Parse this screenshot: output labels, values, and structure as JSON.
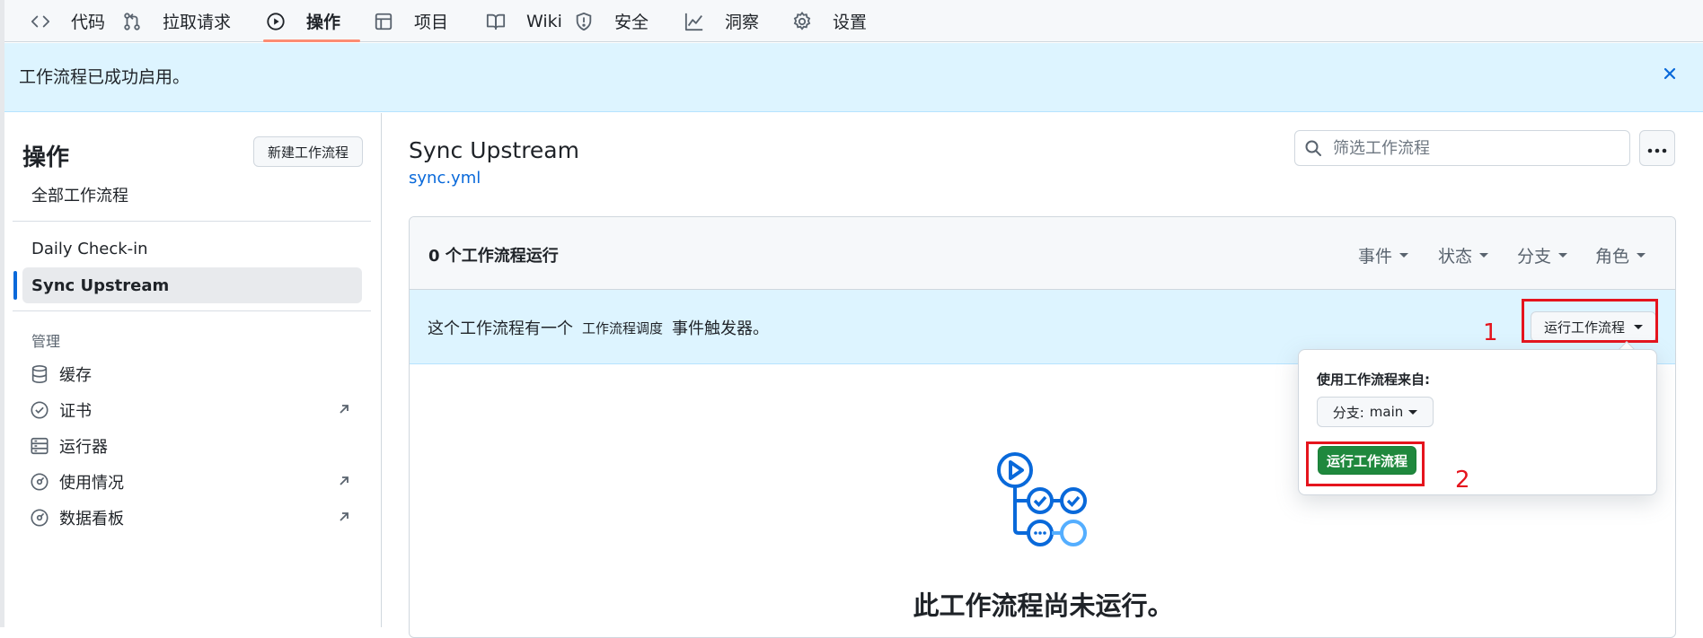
{
  "nav": {
    "tabs": [
      {
        "label": "代码",
        "icon": "code-icon"
      },
      {
        "label": "拉取请求",
        "icon": "pull-request-icon"
      },
      {
        "label": "操作",
        "icon": "play-icon",
        "selected": true
      },
      {
        "label": "项目",
        "icon": "table-icon"
      },
      {
        "label": "Wiki",
        "icon": "book-icon"
      },
      {
        "label": "安全",
        "icon": "shield-icon"
      },
      {
        "label": "洞察",
        "icon": "graph-icon"
      },
      {
        "label": "设置",
        "icon": "gear-icon"
      }
    ]
  },
  "flash": {
    "message": "工作流程已成功启用。",
    "close_icon": "close-icon"
  },
  "sidebar": {
    "title": "操作",
    "new_workflow_label": "新建工作流程",
    "all_workflows_label": "全部工作流程",
    "workflows": [
      {
        "label": "Daily Check-in",
        "selected": false
      },
      {
        "label": "Sync Upstream",
        "selected": true
      }
    ],
    "management_label": "管理",
    "management_items": [
      {
        "label": "缓存",
        "icon": "database-icon",
        "external": false
      },
      {
        "label": "证书",
        "icon": "check-circle-icon",
        "external": true
      },
      {
        "label": "运行器",
        "icon": "server-icon",
        "external": false
      },
      {
        "label": "使用情况",
        "icon": "meter-icon",
        "external": true
      },
      {
        "label": "数据看板",
        "icon": "meter-icon",
        "external": true
      }
    ]
  },
  "main": {
    "workflow_title": "Sync Upstream",
    "workflow_file": "sync.yml",
    "search_placeholder": "筛选工作流程",
    "runs_count_label": "0 个工作流程运行",
    "filters": [
      "事件",
      "状态",
      "分支",
      "角色"
    ],
    "dispatch": {
      "text_before": "这个工作流程有一个",
      "code": "工作流程调度",
      "text_after": "事件触发器。",
      "run_button_label": "运行工作流程"
    },
    "empty_title": "此工作流程尚未运行。"
  },
  "popover": {
    "title": "使用工作流程来自:",
    "branch_label": "分支:",
    "branch_value": "main",
    "run_button_label": "运行工作流程"
  },
  "annotations": {
    "first": "1",
    "second": "2",
    "color": "#e5141d"
  },
  "colors": {
    "accent": "#0969da",
    "flash_bg": "#ddf4ff",
    "green": "#1f883d",
    "tab_underline": "#fd8c73"
  }
}
